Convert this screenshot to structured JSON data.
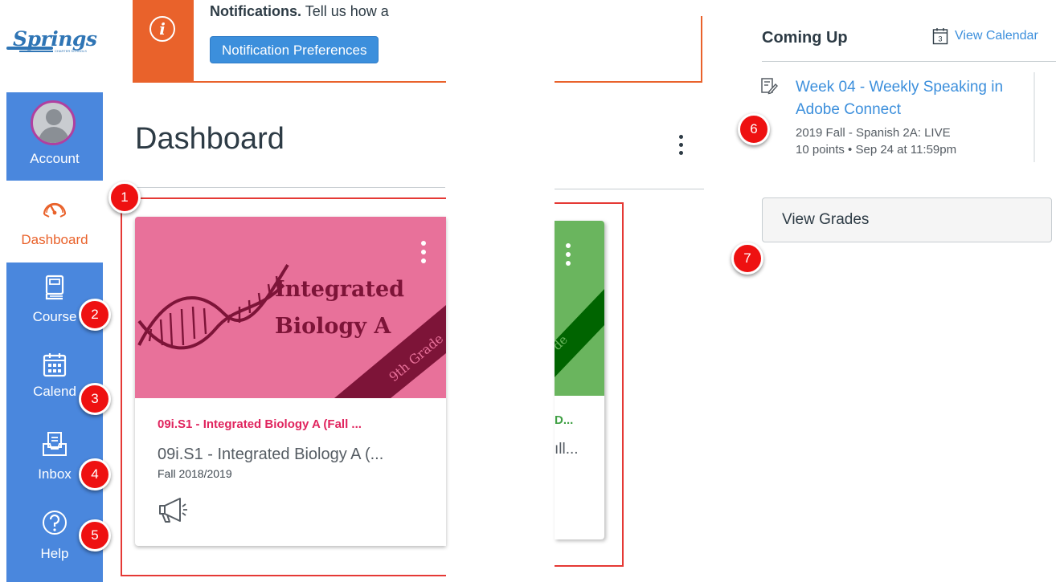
{
  "brand": {
    "logo_text": "Springs",
    "logo_subtext": "CHARTER SCHOOLS"
  },
  "nav": {
    "items": [
      {
        "label": "Account",
        "icon": "avatar"
      },
      {
        "label": "Dashboard",
        "icon": "dashboard-icon"
      },
      {
        "label": "Course",
        "icon": "courses-icon"
      },
      {
        "label": "Calend",
        "icon": "calendar-icon"
      },
      {
        "label": "Inbox",
        "icon": "inbox-icon"
      },
      {
        "label": "Help",
        "icon": "help-icon"
      }
    ],
    "colors": {
      "background": "#4a87dd",
      "active_text": "#e9622b"
    }
  },
  "notification": {
    "title": "Notifications.",
    "body": "Tell us how a",
    "button_label": "Notification Preferences",
    "color": "#e9622b"
  },
  "dashboard": {
    "title": "Dashboard",
    "cards": [
      {
        "hero_title": "Integrated Biology A",
        "ribbon": "9th Grade",
        "name": "09i.S1 - Integrated Biology A (Fall ...",
        "code": "09i.S1 - Integrated Biology A (...",
        "term": "Fall 2018/2019",
        "color": "#e8719a"
      },
      {
        "ribbon": "de",
        "name": "D...",
        "code": "ıll...",
        "color": "#6ab55e"
      }
    ]
  },
  "coming_up": {
    "title": "Coming Up",
    "calendar_link": "View Calendar",
    "calendar_day": "3",
    "items": [
      {
        "title": "Week 04 - Weekly Speaking in Adobe Connect",
        "course": "2019 Fall - Spanish 2A: LIVE",
        "meta": "10 points • Sep 24 at 11:59pm"
      }
    ]
  },
  "grades_button": "View Grades",
  "callouts": [
    "1",
    "2",
    "3",
    "4",
    "5",
    "6",
    "7"
  ]
}
